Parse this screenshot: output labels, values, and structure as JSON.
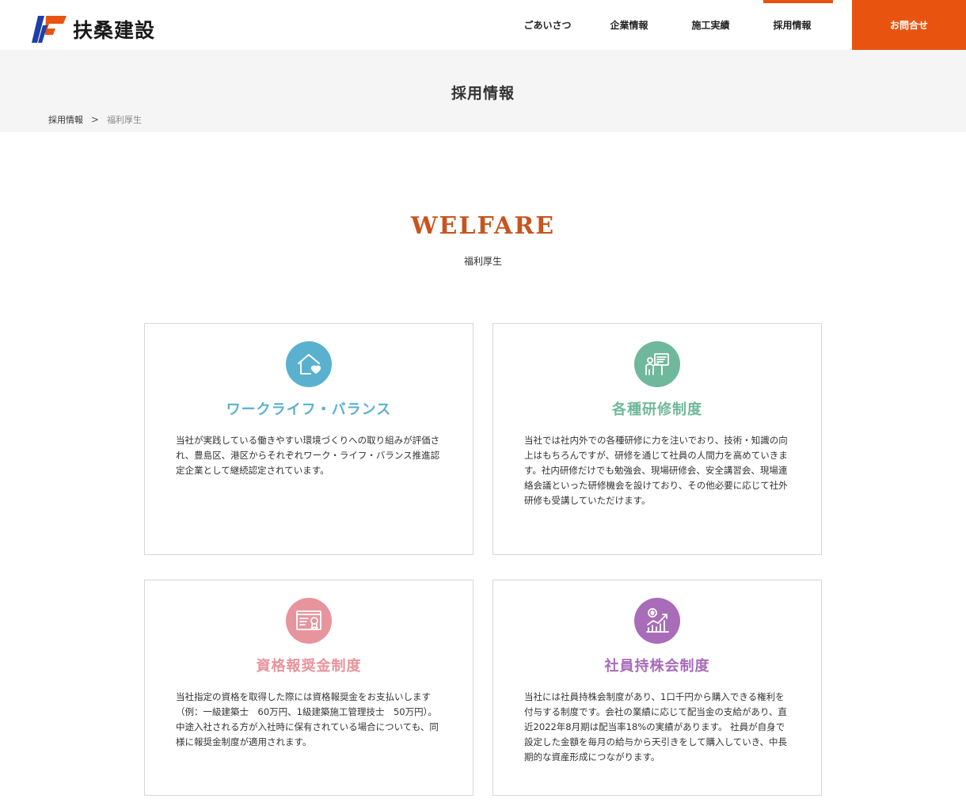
{
  "header": {
    "logo_text": "扶桑建設",
    "nav": [
      "ごあいさつ",
      "企業情報",
      "施工実績",
      "採用情報"
    ],
    "active_nav": "採用情報",
    "contact_label": "お問合せ",
    "brand_color": "#e85410"
  },
  "hero": {
    "title": "採用情報",
    "breadcrumb": {
      "parent": "採用情報",
      "separator": ">",
      "current": "福利厚生"
    }
  },
  "section": {
    "title": "WELFARE",
    "subtitle": "福利厚生"
  },
  "cards": [
    {
      "icon": "house-heart-icon",
      "color": "#5ab1cf",
      "title": "ワークライフ・バランス",
      "body": "当社が実践している働きやすい環境づくりへの取り組みが評価され、豊島区、港区からそれぞれワーク・ライフ・バランス推進認定企業として継続認定されています。"
    },
    {
      "icon": "training-presentation-icon",
      "color": "#6fb89b",
      "title": "各種研修制度",
      "body": "当社では社内外での各種研修に力を注いでおり、技術・知識の向上はもちろんですが、研修を通じて社員の人間力を高めていきます。社内研修だけでも勉強会、現場研修会、安全講習会、現場連絡会議といった研修機会を設けており、その他必要に応じて社外研修も受講していただけます。"
    },
    {
      "icon": "certificate-icon",
      "color": "#e7949d",
      "title": "資格報奨金制度",
      "body": "当社指定の資格を取得した際には資格報奨金をお支払いします（例：一級建築士　60万円、1級建築施工管理技士　50万円）。 中途入社される方が入社時に保有されている場合についても、同様に報奨金制度が適用されます。"
    },
    {
      "icon": "stock-growth-icon",
      "color": "#a86cb8",
      "title": "社員持株会制度",
      "body": "当社には社員持株会制度があり、1口千円から購入できる権利を付与する制度です。会社の業績に応じて配当金の支給があり、直近2022年8月期は配当率18%の実績があります。 社員が自身で設定した金額を毎月の給与から天引きをして購入していき、中長期的な資産形成につながります。"
    }
  ]
}
